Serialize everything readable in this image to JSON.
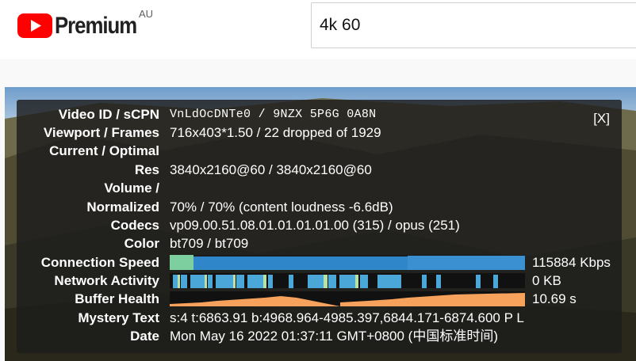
{
  "header": {
    "logo_text": "Premium",
    "region": "AU",
    "search_value": "4k 60"
  },
  "colors": {
    "brand_red": "#ff0000",
    "connection_graph": "#2f86c9",
    "connection_graph_tail": "#7ecf9f",
    "network_graph": "#4aa7d8",
    "buffer_graph": "#f7a25c"
  },
  "stats": {
    "close_label": "[X]",
    "rows": [
      {
        "label": "Video ID / sCPN",
        "value": "VnLdOcDNTe0 / 9NZX 5P6G 0A8N"
      },
      {
        "label": "Viewport / Frames",
        "value": "716x403*1.50 / 22 dropped of 1929"
      },
      {
        "label": "Current / Optimal",
        "value": ""
      },
      {
        "label": "Res",
        "value": "3840x2160@60 / 3840x2160@60"
      },
      {
        "label": "Volume /",
        "value": ""
      },
      {
        "label": "Normalized",
        "value": "70% / 70% (content loudness -6.6dB)"
      },
      {
        "label": "Codecs",
        "value": "vp09.00.51.08.01.01.01.01.00 (315) / opus (251)"
      },
      {
        "label": "Color",
        "value": "bt709 / bt709"
      }
    ],
    "graphs": [
      {
        "label": "Connection Speed",
        "value": "115884 Kbps"
      },
      {
        "label": "Network Activity",
        "value": "0 KB"
      },
      {
        "label": "Buffer Health",
        "value": "10.69 s"
      }
    ],
    "tail_rows": [
      {
        "label": "Mystery Text",
        "value": "s:4 t:6863.91 b:4968.964-4985.397,6844.171-6874.600 P L"
      },
      {
        "label": "Date",
        "value": "Mon May 16 2022 01:37:11 GMT+0800 (中国标准时间)"
      }
    ]
  }
}
